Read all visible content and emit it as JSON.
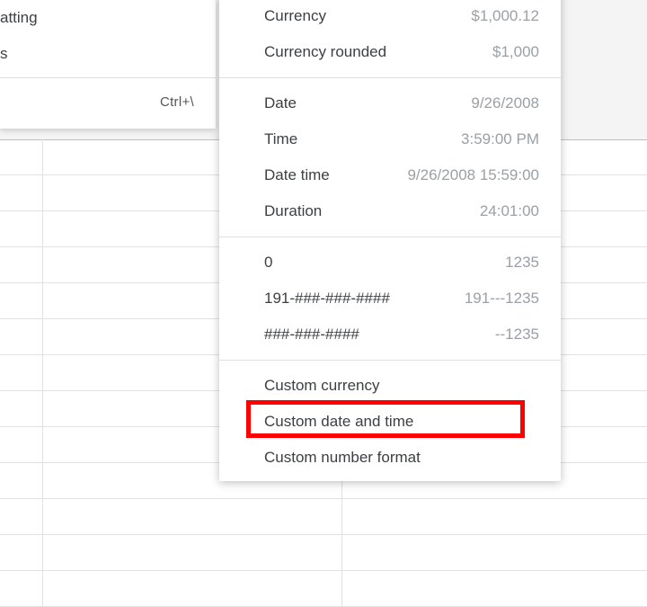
{
  "leftMenu": {
    "items": [
      {
        "label": "atting",
        "shortcut": ""
      },
      {
        "label": "s",
        "shortcut": ""
      }
    ],
    "afterSepItem": {
      "label": "",
      "shortcut": "Ctrl+\\"
    }
  },
  "flyout": {
    "groups": [
      [
        {
          "label": "Currency",
          "example": "$1,000.12"
        },
        {
          "label": "Currency rounded",
          "example": "$1,000"
        }
      ],
      [
        {
          "label": "Date",
          "example": "9/26/2008"
        },
        {
          "label": "Time",
          "example": "3:59:00 PM"
        },
        {
          "label": "Date time",
          "example": "9/26/2008 15:59:00"
        },
        {
          "label": "Duration",
          "example": "24:01:00"
        }
      ],
      [
        {
          "label": "0",
          "example": "1235"
        },
        {
          "label": "191-###-###-####",
          "example": "191---1235"
        },
        {
          "label": "###-###-####",
          "example": "--1235"
        }
      ],
      [
        {
          "label": "Custom currency",
          "example": ""
        },
        {
          "label": "Custom date and time",
          "example": ""
        },
        {
          "label": "Custom number format",
          "example": ""
        }
      ]
    ]
  }
}
